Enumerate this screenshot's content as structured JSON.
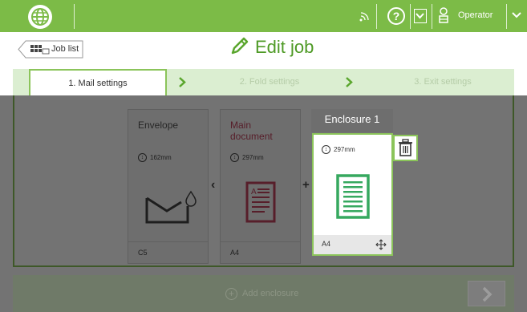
{
  "topbar": {
    "user_label": "Operator",
    "icons": [
      "globe-logo-icon",
      "signal-icon",
      "help-icon",
      "chevron-down-icon",
      "operator-icon",
      "chevron-down-icon"
    ]
  },
  "header": {
    "back_label": "Job list",
    "title": "Edit job",
    "title_icon": "pencil-icon"
  },
  "steps": [
    {
      "label": "1. Mail settings",
      "active": true
    },
    {
      "label": "2. Fold settings",
      "active": false
    },
    {
      "label": "3. Exit settings",
      "active": false
    }
  ],
  "cards": {
    "envelope": {
      "title": "Envelope",
      "size": "162mm",
      "format": "C5"
    },
    "main_document": {
      "title": "Main document",
      "size": "297mm",
      "format": "A4"
    },
    "enclosure": {
      "title": "Enclosure 1",
      "size": "297mm",
      "format": "A4"
    }
  },
  "bottom": {
    "add_label": "Add enclosure"
  },
  "colors": {
    "brand_green": "#7cbb47",
    "light_green": "#dbeed1",
    "accent_green": "#8bc45a",
    "doc_green": "#36a85f",
    "doc_red": "#c0445e",
    "title_green": "#4e9a25"
  }
}
